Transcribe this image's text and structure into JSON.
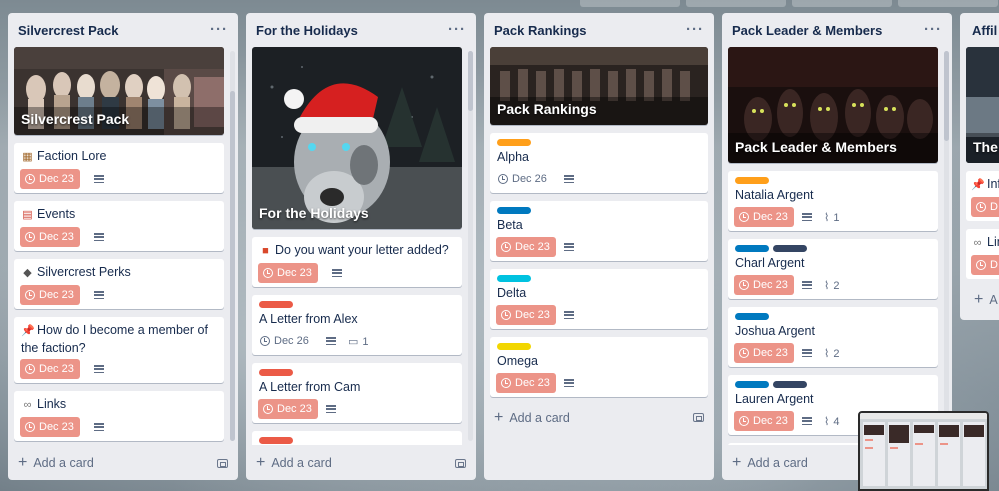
{
  "lists": [
    {
      "title": "Silvercrest Pack",
      "cover_title": "Silvercrest Pack",
      "cards": [
        {
          "icon": "book-stack-icon",
          "glyph": "▦",
          "title": "Faction Lore",
          "due": "Dec 23"
        },
        {
          "icon": "calendar-icon",
          "glyph": "▤",
          "title": "Events",
          "due": "Dec 23"
        },
        {
          "icon": "wolf-icon",
          "glyph": "◆",
          "title": "Silvercrest Perks",
          "due": "Dec 23"
        },
        {
          "icon": "pushpin-icon",
          "glyph": "📌",
          "title": "How do I become a member of the faction?",
          "due": "Dec 23"
        },
        {
          "icon": "link-icon",
          "glyph": "∞",
          "title": "Links",
          "due": "Dec 23"
        }
      ],
      "add_label": "Add a card"
    },
    {
      "title": "For the Holidays",
      "cover_title": "For the Holidays",
      "cards": [
        {
          "icon": "gift-icon",
          "glyph": "■",
          "title": "Do you want your letter added?",
          "due": "Dec 23"
        },
        {
          "label": "#eb5a46",
          "title": "A Letter from Alex",
          "due": "Dec 26",
          "comments": "1"
        },
        {
          "label": "#eb5a46",
          "title": "A Letter from Cam",
          "due": "Dec 23"
        }
      ],
      "add_label": "Add a card"
    },
    {
      "title": "Pack Rankings",
      "cover_title": "Pack Rankings",
      "cards": [
        {
          "label": "#ff9f1a",
          "title": "Alpha",
          "due": "Dec 26"
        },
        {
          "label": "#0079bf",
          "title": "Beta",
          "due": "Dec 23"
        },
        {
          "label": "#00c2e0",
          "title": "Delta",
          "due": "Dec 23"
        },
        {
          "label": "#f2d600",
          "title": "Omega",
          "due": "Dec 23"
        }
      ],
      "add_label": "Add a card"
    },
    {
      "title": "Pack Leader & Members",
      "cover_title": "Pack Leader & Members",
      "cards": [
        {
          "label": "#ff9f1a",
          "title": "Natalia Argent",
          "due": "Dec 23",
          "attachments": "1"
        },
        {
          "labels": [
            "#0079bf",
            "#344563"
          ],
          "title": "Charl Argent",
          "due": "Dec 23",
          "attachments": "2"
        },
        {
          "label": "#0079bf",
          "title": "Joshua Argent",
          "due": "Dec 23",
          "attachments": "2"
        },
        {
          "labels": [
            "#0079bf",
            "#344563"
          ],
          "title": "Lauren Argent",
          "due": "Dec 23",
          "attachments": "4"
        }
      ],
      "add_label": "Add a card"
    },
    {
      "title": "Affil",
      "cover_title": "The",
      "cards": [
        {
          "icon": "pushpin-icon",
          "title": "Inf",
          "due": "D"
        },
        {
          "icon": "link-icon",
          "title": "Lin",
          "due": "D"
        }
      ],
      "add_label": "A"
    }
  ],
  "colors": {
    "due_overdue": "#ec9488",
    "list_bg": "#ebecf0",
    "text": "#172b4d",
    "muted": "#5e6c84"
  }
}
